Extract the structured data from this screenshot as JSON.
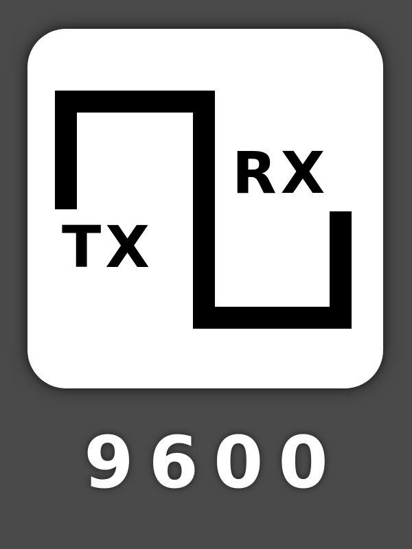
{
  "icon": {
    "name": "serial-tx-rx-icon",
    "background_color": "#4a4a4a",
    "tile_color": "#ffffff",
    "stroke_color": "#000000",
    "tx_label": "TX",
    "rx_label": "RX"
  },
  "baud_rate": "9600"
}
